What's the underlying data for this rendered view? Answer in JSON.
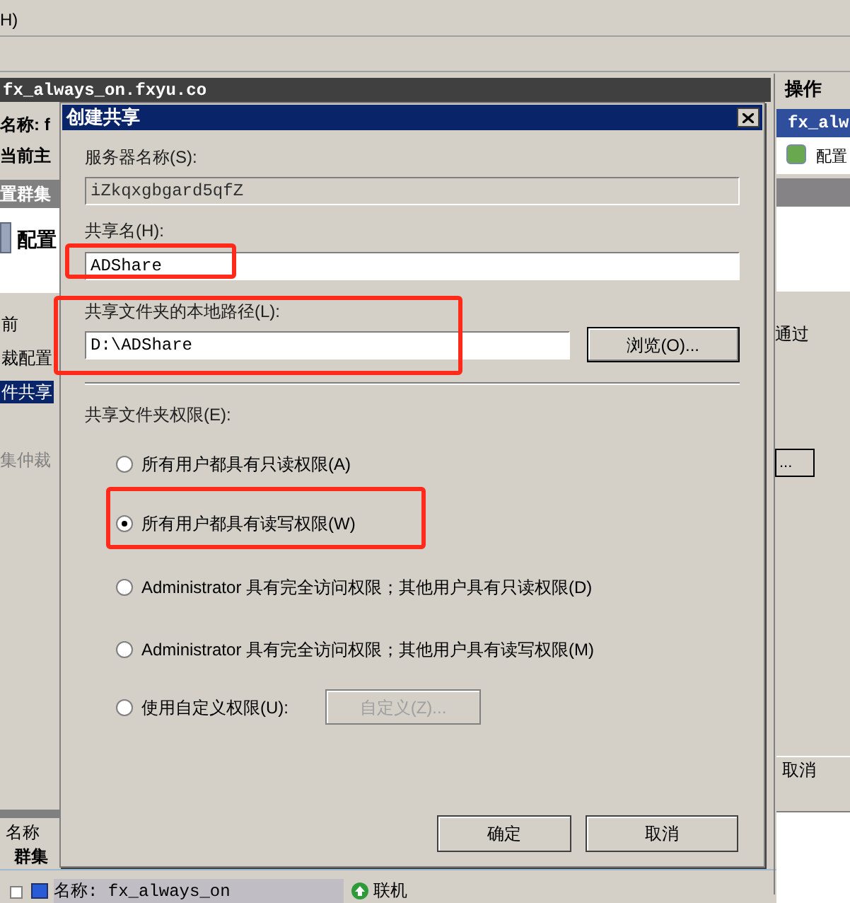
{
  "background": {
    "menu_text": "H)",
    "server_title": "fx_always_on.fxyu.co",
    "name_label": "名称: f",
    "current_host": "当前主",
    "section_header": "置群集",
    "config_label": "配置",
    "nav_items": [
      {
        "label": "前",
        "selected": false
      },
      {
        "label": "裁配置",
        "selected": false
      },
      {
        "label": "件共享",
        "selected": true
      }
    ],
    "quorum_label": "集仲裁",
    "right_pane": {
      "title": "操作",
      "header": "fx_alw",
      "action": "配置",
      "pass_text": "通过",
      "button": "...",
      "cancel": "取消"
    },
    "bottom": {
      "column": "名称",
      "group": "群集",
      "tree_item": "名称: fx_always_on",
      "status": "联机"
    }
  },
  "dialog": {
    "title": "创建共享",
    "server_label": "服务器名称(S):",
    "server_value": "iZkqxgbgard5qfZ",
    "share_label": "共享名(H):",
    "share_value": "ADShare",
    "path_label": "共享文件夹的本地路径(L):",
    "path_value": "D:\\ADShare",
    "browse": "浏览(O)...",
    "permissions_label": "共享文件夹权限(E):",
    "options": [
      {
        "label": "所有用户都具有只读权限(A)",
        "selected": false
      },
      {
        "label": "所有用户都具有读写权限(W)",
        "selected": true
      },
      {
        "label": "Administrator 具有完全访问权限；其他用户具有只读权限(D)",
        "selected": false
      },
      {
        "label": "Administrator 具有完全访问权限；其他用户具有读写权限(M)",
        "selected": false
      },
      {
        "label": "使用自定义权限(U):",
        "selected": false
      }
    ],
    "custom_button": {
      "label": "自定义(Z)...",
      "disabled": true
    },
    "ok": "确定",
    "cancel": "取消"
  }
}
